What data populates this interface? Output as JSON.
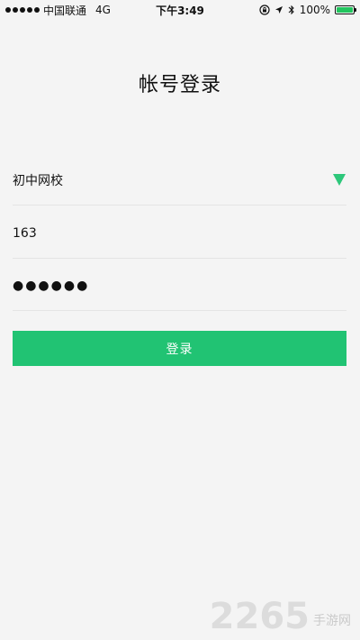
{
  "status_bar": {
    "carrier": "中国联通",
    "network": "4G",
    "time": "下午3:49",
    "battery": "100%",
    "battery_level": 1.0,
    "battery_color": "#22c55e"
  },
  "title": "帐号登录",
  "form": {
    "school": "初中网校",
    "account": "163",
    "password_mask": "●●●●●●"
  },
  "login_button_label": "登录",
  "watermark": {
    "number": "2265",
    "text": "手游网"
  },
  "colors": {
    "accent": "#21c373",
    "background": "#f4f4f4"
  }
}
